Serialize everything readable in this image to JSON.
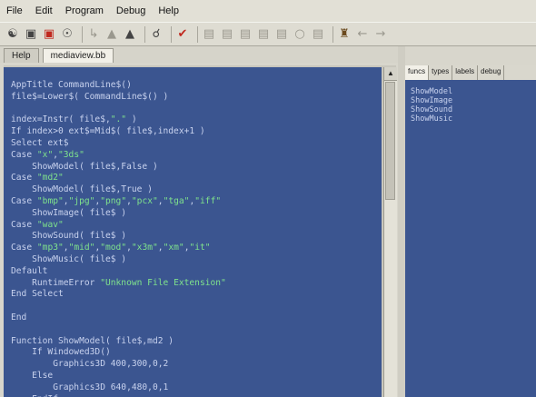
{
  "menu": [
    "File",
    "Edit",
    "Program",
    "Debug",
    "Help"
  ],
  "toolbar": {
    "icons": [
      "open-icon",
      "save-icon",
      "save-all-icon",
      "pin-icon",
      "back-arrow-icon",
      "hat-icon",
      "hat2-icon",
      "find-icon",
      "run-icon",
      "debug-step-icon",
      "debug-step2-icon",
      "debug-step3-icon",
      "debug-step4-icon",
      "debug-step5-icon",
      "debug-watch-icon",
      "debug-stop-icon",
      "home-icon",
      "nav-back-icon",
      "nav-forward-icon"
    ]
  },
  "tabs": [
    "Help",
    "mediaview.bb"
  ],
  "active_tab": 1,
  "side_tabs": [
    "funcs",
    "types",
    "labels",
    "debug"
  ],
  "side_list": [
    "ShowModel",
    "ShowImage",
    "ShowSound",
    "ShowMusic"
  ],
  "code_lines": [
    "AppTitle CommandLine$()",
    "file$=Lower$( CommandLine$() )",
    "",
    "index=Instr( file$,\".\" )",
    "If index>0 ext$=Mid$( file$,index+1 )",
    "Select ext$",
    "Case \"x\",\"3ds\"",
    "    ShowModel( file$,False )",
    "Case \"md2\"",
    "    ShowModel( file$,True )",
    "Case \"bmp\",\"jpg\",\"png\",\"pcx\",\"tga\",\"iff\"",
    "    ShowImage( file$ )",
    "Case \"wav\"",
    "    ShowSound( file$ )",
    "Case \"mp3\",\"mid\",\"mod\",\"x3m\",\"xm\",\"it\"",
    "    ShowMusic( file$ )",
    "Default",
    "    RuntimeError \"Unknown File Extension\"",
    "End Select",
    "",
    "End",
    "",
    "Function ShowModel( file$,md2 )",
    "    If Windowed3D()",
    "        Graphics3D 400,300,0,2",
    "    Else",
    "        Graphics3D 640,480,0,1",
    "    EndIf"
  ]
}
